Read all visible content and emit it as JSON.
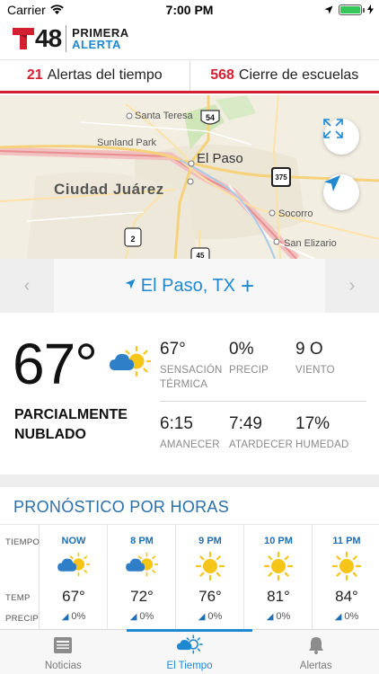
{
  "status_bar": {
    "carrier": "Carrier",
    "time": "7:00 PM"
  },
  "brand": {
    "channel_number": "48",
    "name_top": "PRIMERA",
    "name_bottom": "ALERTA"
  },
  "alerts": {
    "weather_count": "21",
    "weather_label": "Alertas del tiempo",
    "schools_count": "568",
    "schools_label": "Cierre de escuelas"
  },
  "map": {
    "labels": {
      "santa_teresa": "Santa Teresa",
      "sunland_park": "Sunland Park",
      "el_paso": "El Paso",
      "ciudad_juarez": "Ciudad Juárez",
      "socorro": "Socorro",
      "san_elizario": "San Elizario"
    },
    "shields": {
      "us54": "54",
      "i375": "375",
      "mx2": "2",
      "mx45": "45"
    },
    "expand_icon": "expand-icon",
    "locate_icon": "location-arrow-icon"
  },
  "location": {
    "name": "El Paso, TX",
    "add_symbol": "+",
    "prev_symbol": "‹",
    "next_symbol": "›"
  },
  "current": {
    "temperature": "67°",
    "condition": "PARCIALMENTE NUBLADO",
    "icon": "partly-cloudy-icon",
    "stats": {
      "feels_like": {
        "value": "67°",
        "label": "SENSACIÓN TÉRMICA"
      },
      "precip": {
        "value": "0%",
        "label": "PRECIP"
      },
      "wind": {
        "value": "9 O",
        "label": "VIENTO"
      },
      "sunrise": {
        "value": "6:15",
        "label": "AMANECER"
      },
      "sunset": {
        "value": "7:49",
        "label": "ATARDECER"
      },
      "humidity": {
        "value": "17%",
        "label": "HUMEDAD"
      }
    }
  },
  "hourly": {
    "title": "PRONÓSTICO POR HORAS",
    "row_labels": {
      "time": "TIEMPO",
      "temp": "TEMP",
      "precip": "PRECIP"
    },
    "items": [
      {
        "time": "NOW",
        "icon": "partly-cloudy-icon",
        "temp": "67°",
        "precip": "0%"
      },
      {
        "time": "8 PM",
        "icon": "partly-cloudy-icon",
        "temp": "72°",
        "precip": "0%"
      },
      {
        "time": "9 PM",
        "icon": "sun-icon",
        "temp": "76°",
        "precip": "0%"
      },
      {
        "time": "10 PM",
        "icon": "sun-icon",
        "temp": "81°",
        "precip": "0%"
      },
      {
        "time": "11 PM",
        "icon": "sun-icon",
        "temp": "84°",
        "precip": "0%"
      }
    ]
  },
  "tabs": [
    {
      "label": "Noticias",
      "icon": "newspaper-icon",
      "active": false
    },
    {
      "label": "El Tiempo",
      "icon": "partly-cloudy-icon",
      "active": true
    },
    {
      "label": "Alertas",
      "icon": "bell-icon",
      "active": false
    }
  ],
  "colors": {
    "accent": "#1e88d0",
    "alert_red": "#d32030",
    "sun": "#f5c518",
    "cloud": "#2f7fc8"
  }
}
